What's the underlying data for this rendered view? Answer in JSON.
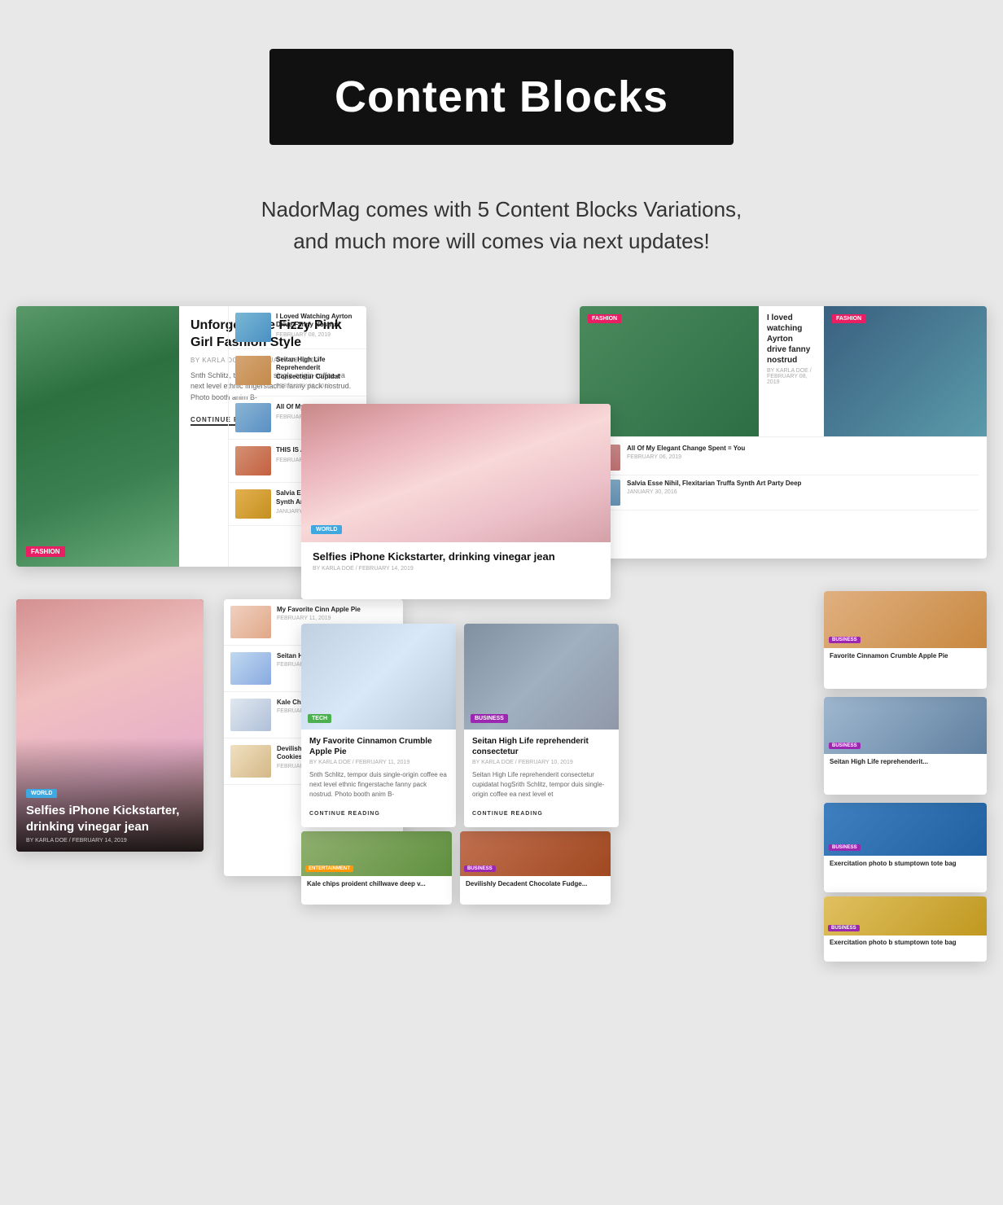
{
  "page": {
    "background_color": "#e8e8e8"
  },
  "header": {
    "title": "Content Blocks",
    "subtitle_line1": "NadorMag comes with 5 Content Blocks Variations,",
    "subtitle_line2": "and much more will comes via next updates!"
  },
  "card1": {
    "category": "FASHION",
    "title": "Unforgettable Fizzy Pink Girl Fashion Style",
    "meta": "BY  KARLA DOE / FEBRUARY 08, 2019",
    "excerpt": "Snth Schlitz, tempor duis single-origin coffee ea next level ethnic fingerstache fanny pack nostrud. Photo booth anim B-",
    "continue": "CONTINUE READING",
    "list_items": [
      {
        "title": "I Loved Watching Ayrton Drive Fanny Nostrud",
        "date": "FEBRUARY 08, 2019"
      },
      {
        "title": "Seitan High Life Reprehenderit Consectetur Cupidat",
        "date": "FEBRUARY 08, 2019"
      },
      {
        "title": "All Of My Elegant Ch You",
        "date": "FEBRUARY 08, 2019"
      },
      {
        "title": "THIS IS A STICKY PO",
        "date": "FEBRUARY 27, 2016"
      },
      {
        "title": "Salvia Esse Nihil, Fle Synth Art Party Deep",
        "date": "JANUARY 30, 2016"
      }
    ]
  },
  "card2": {
    "category": "WORLD",
    "title": "Selfies iPhone Kickstarter, drinking vinegar jean",
    "meta": "BY  KARLA DOE /  FEBRUARY 14, 2019"
  },
  "card3": {
    "category1": "FASHION",
    "category2": "FASHION",
    "article1_title": "I loved watching Ayrton drive fanny nostrud",
    "article1_meta": "BY  KARLA DOE / FEBRUARY 08, 2019",
    "article2_title": "All Of My Elegant Change Spent = You",
    "list_items": [
      {
        "title": "All Of My Elegant Change Spent = You",
        "date": "FEBRUARY 06, 2019"
      },
      {
        "title": "Salvia Esse Nihil, Flexitarian Truffa Synth Art Party Deep",
        "date": "JANUARY 30, 2016"
      }
    ]
  },
  "card4": {
    "category": "WORLD",
    "title": "Selfies iPhone Kickstarter, drinking vinegar jean",
    "meta": "BY KARLA DOE / FEBRUARY 14, 2019"
  },
  "card5": {
    "items": [
      {
        "title": "My Favorite Cinn Apple Pie",
        "date": "FEBRUARY 11, 2019"
      },
      {
        "title": "Seitan High Life R Consectetur",
        "date": "FEBRUARY 10, 2019"
      },
      {
        "title": "Kale Chips Proid Laborum",
        "date": "FEBRUARY 10, 2019"
      },
      {
        "title": "Devilishly Decadent Chocolate Fudge Cookies",
        "date": "FEBRUARY 09, 2019"
      }
    ]
  },
  "card6": {
    "category": "TECH",
    "title": "My Favorite Cinnamon Crumble Apple Pie",
    "meta": "BY  KARLA DOE /  FEBRUARY 11, 2019",
    "excerpt": "Snth Schlitz, tempor duis single-origin coffee ea next level ethnic fingerstache fanny pack nostrud. Photo booth anim B-",
    "continue": "CONTINUE READING"
  },
  "card7": {
    "category": "BUSINESS",
    "title": "Seitan High Life reprehenderit consectetur",
    "meta": "BY  KARLA DOE /  FEBRUARY 10, 2019",
    "excerpt": "Seitan High Life reprehenderit consectetur cupidatat hogSrith Schlitz, tempor duis single-origin coffee ea next level et",
    "continue": "CONTINUE READING"
  },
  "card_r1": {
    "category": "BUSINESS",
    "title": "Favorite Cinnamon Crumble Apple Pie"
  },
  "card_r2": {
    "category": "BUSINESS",
    "title": "Seitan High Life reprehenderit..."
  },
  "card_r3": {
    "category": "BUSINESS",
    "title": "Exercitation photo b stumptown tote bag"
  },
  "card_b1": {
    "category": "ENTERTAINMENT",
    "title": "Kale chips proident chillwave deep v..."
  },
  "card_b2": {
    "category": "BUSINESS",
    "title": "Devilishly Decadent Chocolate Fudge..."
  },
  "card_b3": {
    "category": "BUSINESS",
    "title": "Exercitation photo b stumptown tote bag"
  },
  "badges": {
    "fashion": "#e91e63",
    "world": "#3fa8e0",
    "tech": "#4caf50",
    "business": "#9c27b0",
    "entertainment": "#ff9800"
  }
}
